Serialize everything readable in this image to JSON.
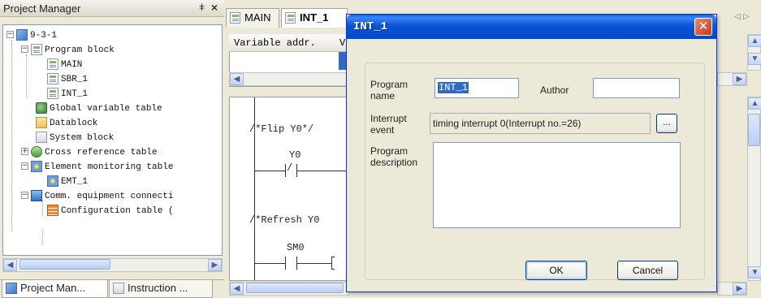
{
  "project_manager": {
    "title": "Project Manager",
    "pin_glyph": "#",
    "close_glyph": "×",
    "tree": [
      {
        "label": "9-3-1",
        "icon": "project-icon"
      },
      {
        "label": "Program block",
        "icon": "folder-doc-icon"
      },
      {
        "label": "MAIN",
        "icon": "program-icon"
      },
      {
        "label": "SBR_1",
        "icon": "program-icon"
      },
      {
        "label": "INT_1",
        "icon": "program-icon"
      },
      {
        "label": "Global variable table",
        "icon": "globe-icon"
      },
      {
        "label": "Datablock",
        "icon": "datablock-icon"
      },
      {
        "label": "System block",
        "icon": "system-block-icon"
      },
      {
        "label": "Cross reference table",
        "icon": "cross-reference-icon"
      },
      {
        "label": "Element monitoring table",
        "icon": "monitor-icon"
      },
      {
        "label": "EMT_1",
        "icon": "monitor-icon"
      },
      {
        "label": "Comm. equipment connecti",
        "icon": "comm-icon"
      },
      {
        "label": "Configuration table (",
        "icon": "table-icon"
      }
    ],
    "bottom_tabs": [
      {
        "label": "Project Man...",
        "icon": "project-icon"
      },
      {
        "label": "Instruction ...",
        "icon": "instruction-icon"
      }
    ]
  },
  "editor": {
    "tabs": [
      {
        "label": "MAIN"
      },
      {
        "label": "INT_1"
      }
    ],
    "variable_table_header": "Variable addr.",
    "variable_table_header_clip": "V",
    "ladder": {
      "comment_1": "/*Flip Y0*/",
      "contact_1": "Y0",
      "comment_2": "/*Refresh Y0",
      "contact_2": "SM0"
    }
  },
  "dialog": {
    "title": "INT_1",
    "program_name_label": "Program name",
    "program_name_value": "INT_1",
    "author_label": "Author",
    "author_value": "",
    "interrupt_event_label": "Interrupt event",
    "interrupt_event_value": "timing interrupt 0(Interrupt no.=26)",
    "browse_label": "...",
    "program_description_label": "Program description",
    "program_description_value": "",
    "ok_label": "OK",
    "cancel_label": "Cancel"
  },
  "colors": {
    "title_bar": "#0a54d8",
    "selection": "#316ac5",
    "window_bg": "#ece9d8"
  }
}
